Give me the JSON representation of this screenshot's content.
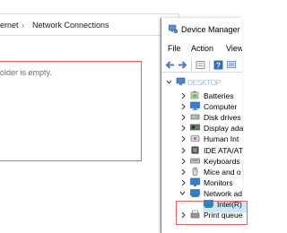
{
  "explorer": {
    "breadcrumb": [
      "ernet",
      "›",
      "Network Connections"
    ],
    "empty_message": "older is empty."
  },
  "device_manager": {
    "title": "Device Manager",
    "menu": [
      "File",
      "Action",
      "View"
    ],
    "root": "DESKTOP",
    "items": [
      {
        "label": "Batteries",
        "icon": "battery-icon"
      },
      {
        "label": "Computer",
        "icon": "computer-icon"
      },
      {
        "label": "Disk drives",
        "icon": "disk-drive-icon"
      },
      {
        "label": "Display ada",
        "icon": "display-adapter-icon"
      },
      {
        "label": "Human Int",
        "icon": "hid-icon"
      },
      {
        "label": "IDE ATA/AT",
        "icon": "ide-icon"
      },
      {
        "label": "Keyboards",
        "icon": "keyboard-icon"
      },
      {
        "label": "Mice and o",
        "icon": "mouse-icon"
      },
      {
        "label": "Monitors",
        "icon": "monitor-icon"
      },
      {
        "label": "Network ad",
        "icon": "network-adapter-icon"
      },
      {
        "label": "Intel(R)",
        "icon": "network-card-icon"
      },
      {
        "label": "Print queue",
        "icon": "printer-icon"
      }
    ]
  },
  "colors": {
    "highlight_border": "#e06666",
    "selection": "#cce8ff",
    "icon_blue": "#2f7ed8"
  }
}
